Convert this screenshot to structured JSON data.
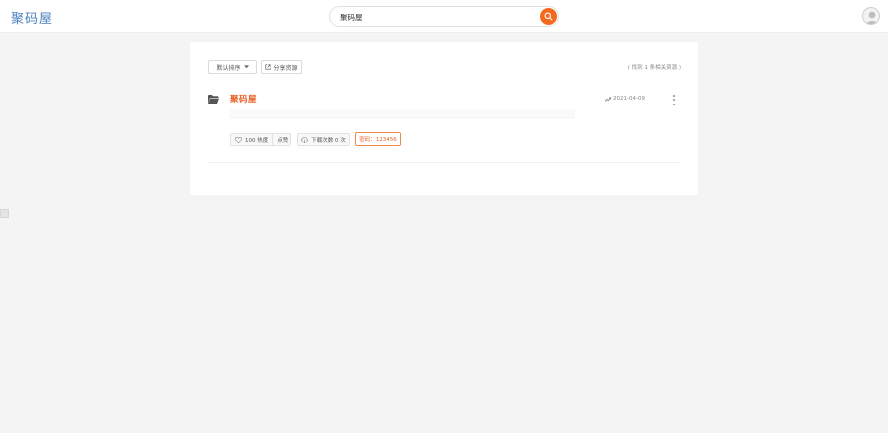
{
  "header": {
    "logo": "聚码屋",
    "search": {
      "value": "聚码屋",
      "placeholder": ""
    }
  },
  "toolbar": {
    "sort_label": "默认排序",
    "share_label": "分享资源",
    "count_text": "( 找到 1 条相关资源 )"
  },
  "results": [
    {
      "title": "聚码屋",
      "date": "2021-04-09",
      "likes_label": "100 热度",
      "like_action": "点赞",
      "download_label": "下载次数 0 次",
      "password_label": "密码：123456"
    }
  ],
  "colors": {
    "accent": "#f36a1e",
    "title": "#e8632a",
    "logo": "#4a7fc1",
    "background": "#f4f4f4"
  }
}
